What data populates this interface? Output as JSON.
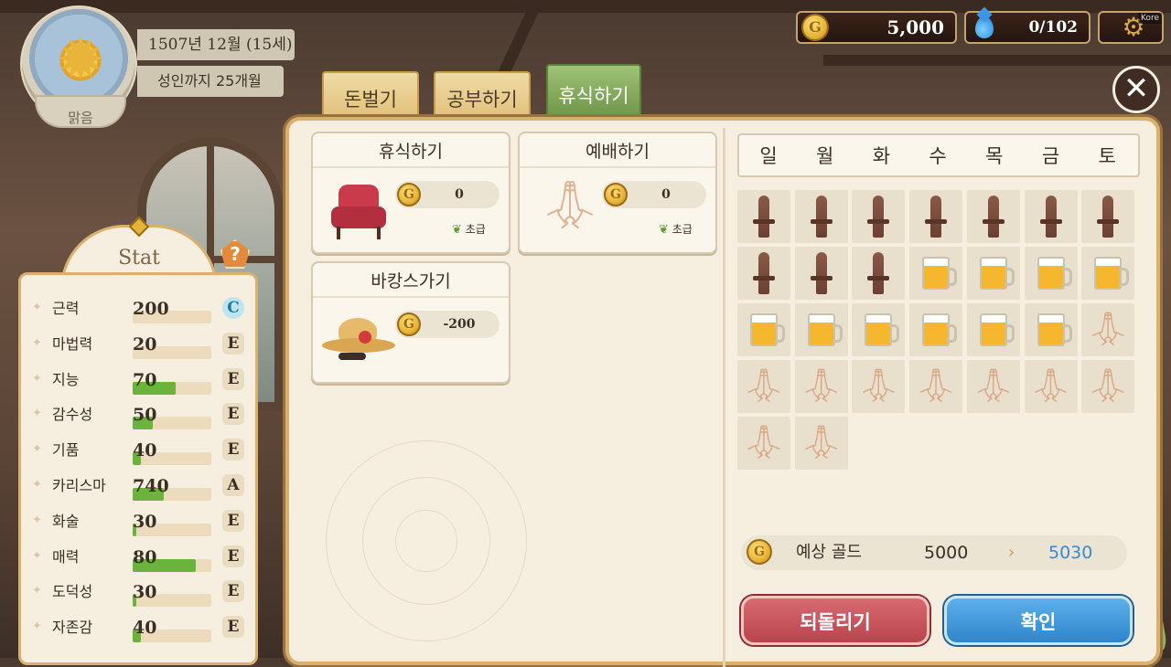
{
  "status": {
    "weather": "맑음",
    "date": "1507년 12월 (15세)",
    "until_adult": "성인까지 25개월"
  },
  "resources": {
    "gold": "5,000",
    "gems": "0/102",
    "lang_tag": "Kore",
    "coin_glyph": "G"
  },
  "tabs": [
    {
      "label": "돈벌기",
      "active": false
    },
    {
      "label": "공부하기",
      "active": false
    },
    {
      "label": "휴식하기",
      "active": true
    }
  ],
  "activities": [
    {
      "title": "휴식하기",
      "cost": "0",
      "grade": "초급",
      "icon": "armchair-icon"
    },
    {
      "title": "예배하기",
      "cost": "0",
      "grade": "초급",
      "icon": "praying-hands-icon"
    },
    {
      "title": "바캉스가기",
      "cost": "-200",
      "icon": "sun-hat-icon"
    }
  ],
  "schedule": {
    "days": [
      "일",
      "월",
      "화",
      "수",
      "목",
      "금",
      "토"
    ],
    "slots": [
      "sword",
      "sword",
      "sword",
      "sword",
      "sword",
      "sword",
      "sword",
      "sword",
      "sword",
      "sword",
      "beer",
      "beer",
      "beer",
      "beer",
      "beer",
      "beer",
      "beer",
      "beer",
      "beer",
      "beer",
      "pray",
      "pray",
      "pray",
      "pray",
      "pray",
      "pray",
      "pray",
      "pray",
      "pray",
      "pray"
    ]
  },
  "estimate": {
    "label": "예상 골드",
    "current": "5000",
    "arrow": "›",
    "result": "5030"
  },
  "buttons": {
    "undo": "되돌리기",
    "confirm": "확인"
  },
  "stat_panel": {
    "title": "Stat",
    "help": "?",
    "stats": [
      {
        "name": "근력",
        "value": "200",
        "fill": 0,
        "grade": "C"
      },
      {
        "name": "마법력",
        "value": "20",
        "fill": 0,
        "grade": "E"
      },
      {
        "name": "지능",
        "value": "70",
        "fill": 0.55,
        "grade": "E"
      },
      {
        "name": "감수성",
        "value": "50",
        "fill": 0.25,
        "grade": "E"
      },
      {
        "name": "기품",
        "value": "40",
        "fill": 0.1,
        "grade": "E"
      },
      {
        "name": "카리스마",
        "value": "740",
        "fill": 0.4,
        "grade": "A"
      },
      {
        "name": "화술",
        "value": "30",
        "fill": 0.05,
        "grade": "E"
      },
      {
        "name": "매력",
        "value": "80",
        "fill": 0.8,
        "grade": "E"
      },
      {
        "name": "도덕성",
        "value": "30",
        "fill": 0.05,
        "grade": "E"
      },
      {
        "name": "자존감",
        "value": "40",
        "fill": 0.1,
        "grade": "E"
      }
    ]
  },
  "colors": {
    "accent_green": "#6cb33e",
    "panel_bg": "#f6eedf",
    "gold_border": "#d9b06d",
    "result_blue": "#3a8ad0",
    "undo_red": "#b9444d",
    "confirm_blue": "#2f85c9"
  }
}
